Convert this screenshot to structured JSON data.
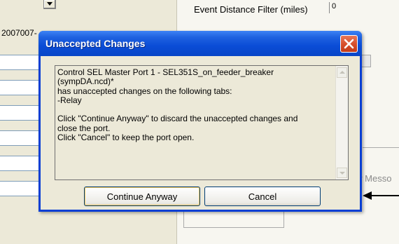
{
  "background": {
    "id_text": "2007007-",
    "event_filter_label": "Event Distance Filter (miles)",
    "event_filter_value": "0",
    "message_label_partial": "er Messo"
  },
  "dialog": {
    "title": "Unaccepted Changes",
    "message": "Control SEL Master Port 1 - SEL351S_on_feeder_breaker\n(sympDA.ncd)*\nhas unaccepted changes on the following tabs:\n-Relay\n\nClick \"Continue Anyway\" to discard the unaccepted changes and\nclose the port.\nClick \"Cancel\" to keep the port open.",
    "continue_label": "Continue Anyway",
    "cancel_label": "Cancel"
  },
  "colors": {
    "titlebar": "#0a4cd6",
    "close_button": "#d64d2a",
    "window_face": "#ece9d8"
  },
  "icons": {
    "close": "close-x-icon",
    "scroll_up": "arrow-up-icon",
    "scroll_down": "arrow-down-icon",
    "dropdown": "chevron-down-icon",
    "pointer": "arrow-left-icon"
  }
}
